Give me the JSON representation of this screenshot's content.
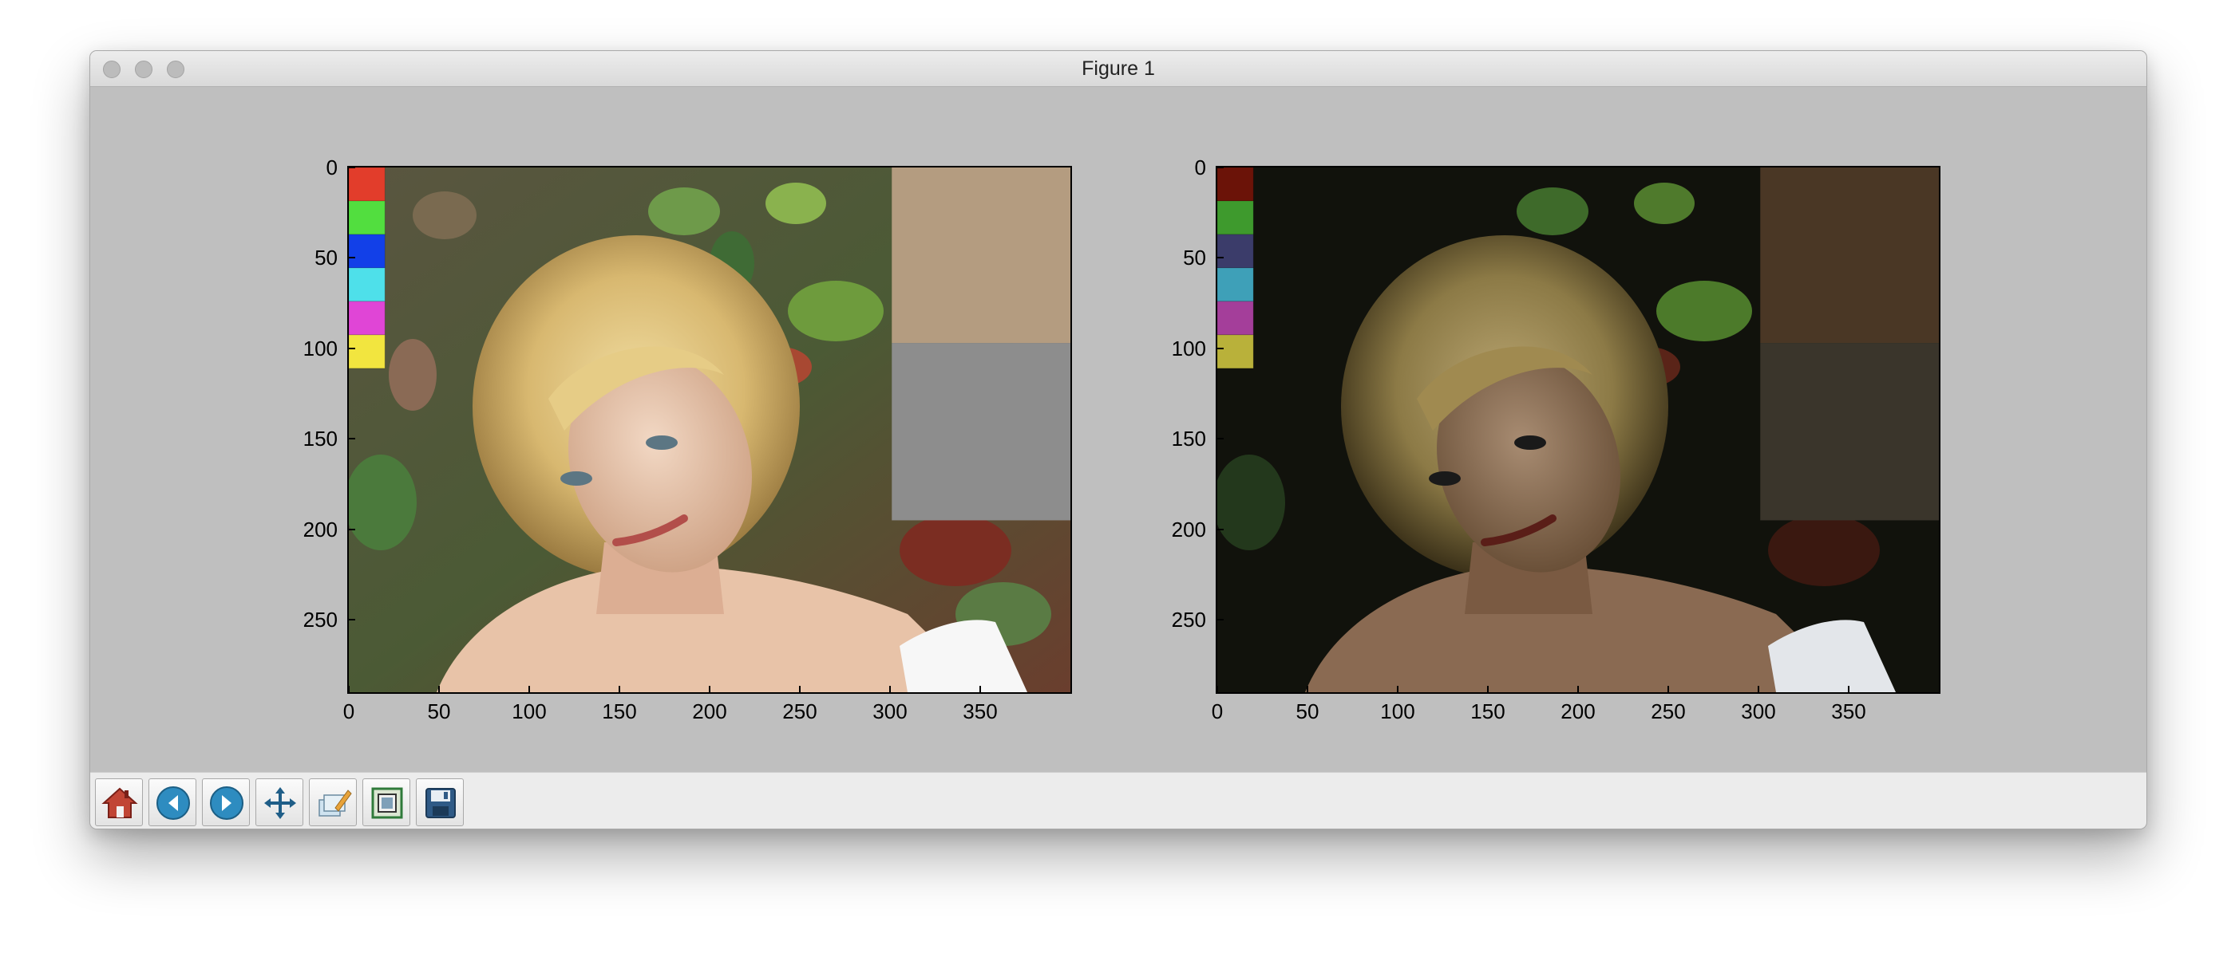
{
  "window": {
    "title": "Figure 1"
  },
  "axes": [
    {
      "name": "left",
      "yticks": [
        "0",
        "50",
        "100",
        "150",
        "200",
        "250"
      ],
      "xticks": [
        "0",
        "50",
        "100",
        "150",
        "200",
        "250",
        "300",
        "350"
      ]
    },
    {
      "name": "right",
      "yticks": [
        "0",
        "50",
        "100",
        "150",
        "200",
        "250"
      ],
      "xticks": [
        "0",
        "50",
        "100",
        "150",
        "200",
        "250",
        "300",
        "350"
      ]
    }
  ],
  "swatches": {
    "left": [
      "#e23d2b",
      "#52de3f",
      "#1240e8",
      "#4ee0ea",
      "#e045d6",
      "#f2e53f"
    ],
    "right": [
      "#6b1308",
      "#3e9a2d",
      "#3b3c6a",
      "#3ea0b8",
      "#a43e9a",
      "#b9b13a"
    ],
    "left_patches": [
      "#b49c80",
      "#8d8d8d"
    ],
    "right_patches": [
      "#4a3725",
      "#3a352b"
    ]
  },
  "toolbar": {
    "buttons": [
      "home-icon",
      "back-icon",
      "forward-icon",
      "pan-icon",
      "configure-subplots-icon",
      "zoom-rect-icon",
      "save-icon"
    ]
  }
}
